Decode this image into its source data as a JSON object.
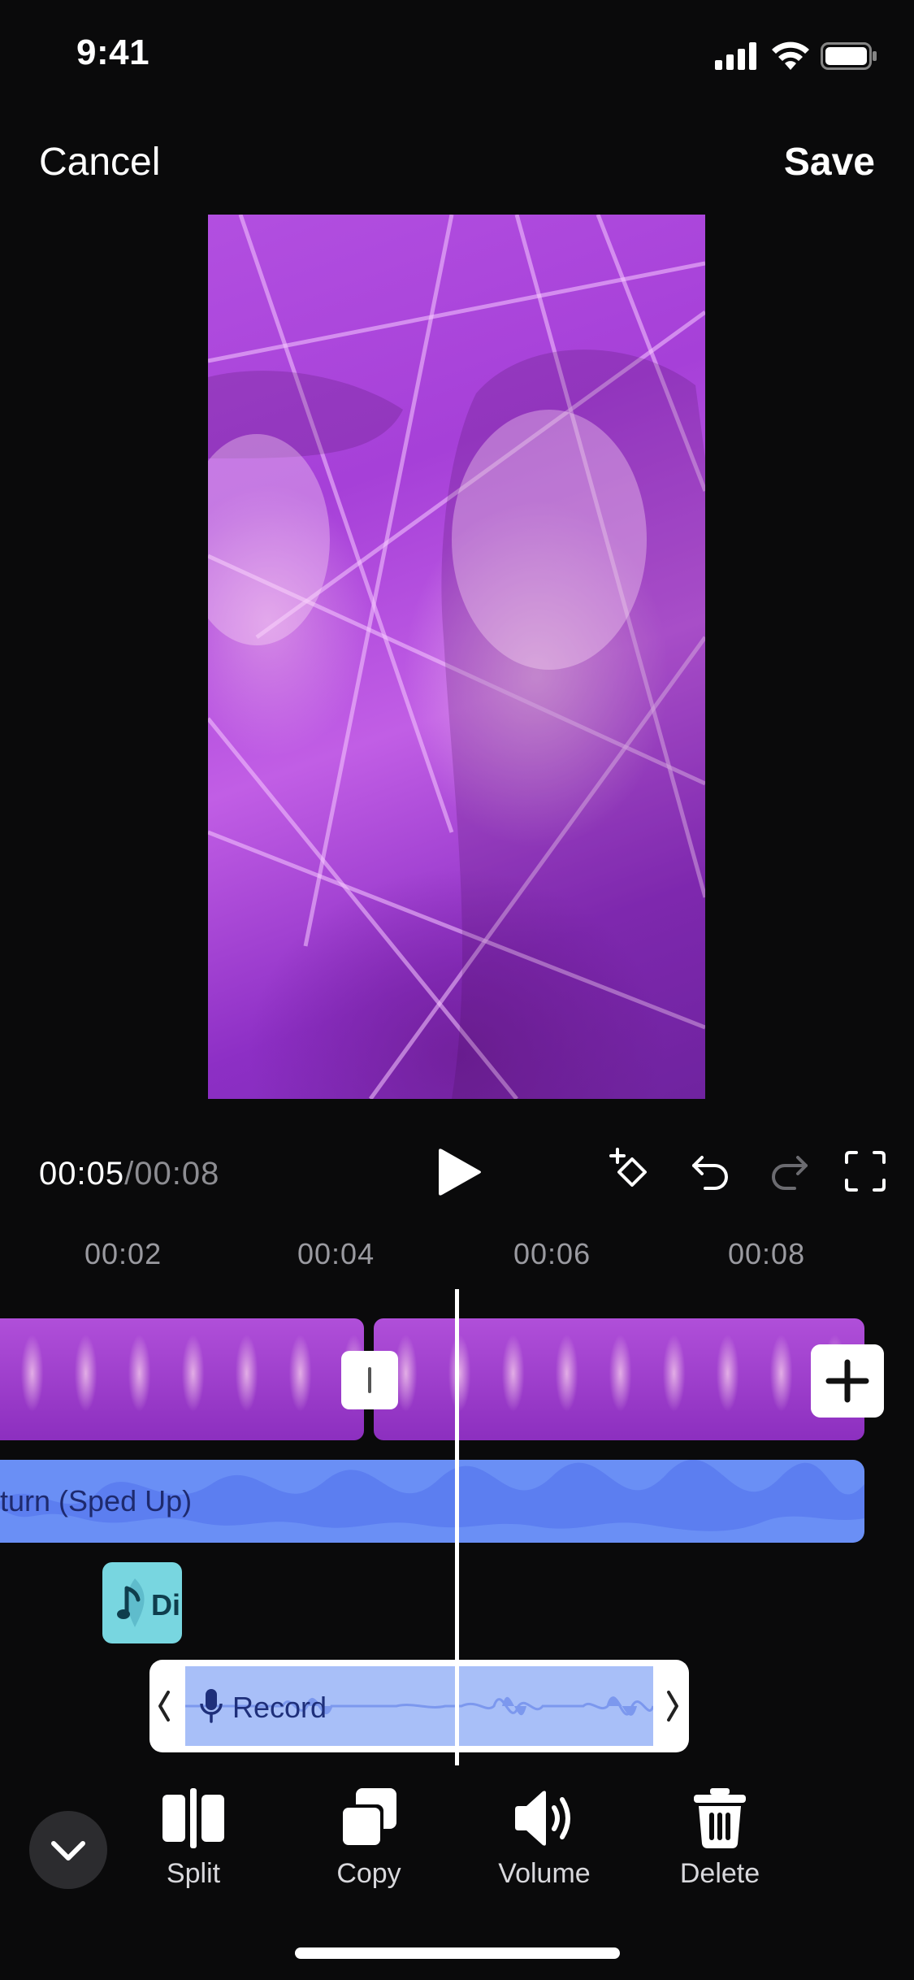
{
  "status_bar": {
    "time": "9:41"
  },
  "header": {
    "cancel_label": "Cancel",
    "save_label": "Save"
  },
  "transport": {
    "current_time": "00:05",
    "separator": "/",
    "total_time": "00:08"
  },
  "ruler": {
    "ticks": [
      "00:02",
      "00:04",
      "00:06",
      "00:08"
    ]
  },
  "tracks": {
    "music": {
      "title_visible": "turn (Sped Up)"
    },
    "sound_effect": {
      "title_visible": "Di"
    },
    "recording": {
      "title": "Record"
    }
  },
  "toolbar": {
    "items": [
      {
        "label": "Split",
        "icon": "split-icon"
      },
      {
        "label": "Copy",
        "icon": "copy-icon"
      },
      {
        "label": "Volume",
        "icon": "volume-icon"
      },
      {
        "label": "Delete",
        "icon": "trash-icon"
      }
    ]
  },
  "colors": {
    "background": "#0a0a0b",
    "music_track": "#6a8ff5",
    "sfx_chip": "#78d6e0",
    "recording_fill": "#a8bff8",
    "clip_purple": "#b04fd9"
  }
}
